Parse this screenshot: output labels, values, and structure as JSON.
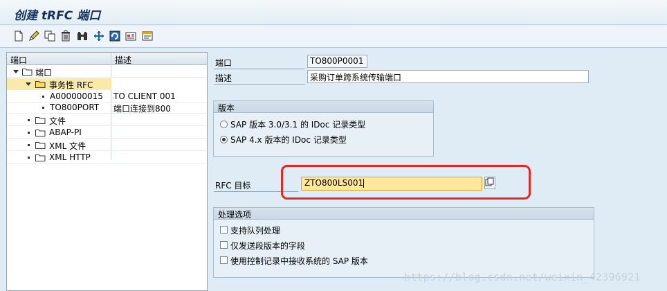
{
  "window": {
    "title": "创建 tRFC 端口"
  },
  "toolbar": {
    "icons": [
      "new-icon",
      "change-icon",
      "copy-icon",
      "delete-icon",
      "binoculars-icon",
      "navigate-icon",
      "refresh-icon",
      "system-icon",
      "detail-icon"
    ]
  },
  "tree": {
    "columns": {
      "name": "端口",
      "description": "描述"
    },
    "root": {
      "label": "端口"
    },
    "transactional_rfc": {
      "label": "事务性 RFC"
    },
    "ports": [
      {
        "name": "A000000015",
        "description": "TO CLIENT 001"
      },
      {
        "name": "TO800PORT",
        "description": "端口连接到800"
      }
    ],
    "other_nodes": [
      {
        "label": "文件"
      },
      {
        "label": "ABAP-PI"
      },
      {
        "label": "XML 文件"
      },
      {
        "label": "XML HTTP"
      }
    ]
  },
  "form": {
    "port_label": "端口",
    "port_value": "TO800P0001",
    "description_label": "描述",
    "description_value": "采购订单跨系统传输端口",
    "version_group": {
      "title": "版本",
      "options": [
        {
          "label": "SAP 版本 3.0/3.1 的 IDoc 记录类型",
          "selected": false
        },
        {
          "label": "SAP 4.x 版本的 IDoc 记录类型",
          "selected": true
        }
      ]
    },
    "rfc_label": "RFC 目标",
    "rfc_value": "ZTO800LS001",
    "processing_group": {
      "title": "处理选项",
      "options": [
        {
          "label": "支持队列处理",
          "checked": false
        },
        {
          "label": "仅发送段版本的字段",
          "checked": false
        },
        {
          "label": "使用控制记录中接收系统的 SAP 版本",
          "checked": false
        }
      ]
    }
  },
  "watermark": "https://blog.csdn.net/weixin_42396921",
  "colors": {
    "background": "#dfebf5",
    "highlight": "#e6261f",
    "active_field": "#ffe79b",
    "selected_row": "#fbe9a8"
  }
}
